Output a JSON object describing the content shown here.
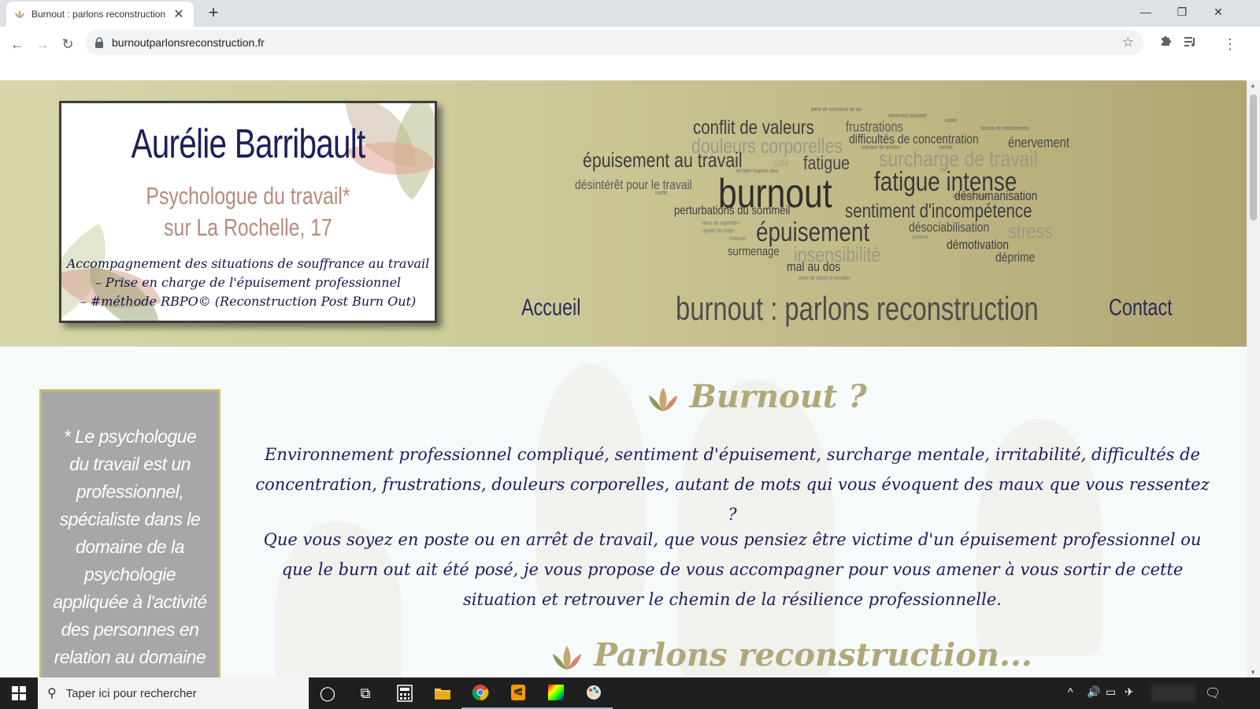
{
  "browser": {
    "tab_title": "Burnout : parlons reconstruction",
    "tab_close": "✕",
    "new_tab": "+",
    "url": "burnoutparlonsreconstruction.fr",
    "win_min": "—",
    "win_max": "❐",
    "win_close": "✕",
    "back": "←",
    "forward": "→",
    "reload": "↻",
    "star": "☆",
    "menu": "⋮"
  },
  "header": {
    "name": "Aurélie Barribault",
    "subtitle_line1": "Psychologue du travail*",
    "subtitle_line2": "sur La Rochelle, 17",
    "desc_line1": "Accompagnement des situations de souffrance au travail",
    "desc_line2": "– Prise en charge de l'épuisement professionnel",
    "desc_line3": "– #méthode RBPO© (Reconstruction Post Burn Out)"
  },
  "word_cloud": [
    {
      "t": "conflit de valeurs"
    },
    {
      "t": "frustrations"
    },
    {
      "t": "douleurs corporelles"
    },
    {
      "t": "difficultés de concentration"
    },
    {
      "t": "énervement"
    },
    {
      "t": "épuisement au travail"
    },
    {
      "t": "fatigue"
    },
    {
      "t": "surcharge de travail"
    },
    {
      "t": "burnout"
    },
    {
      "t": "fatigue intense"
    },
    {
      "t": "désintérêt pour le travail"
    },
    {
      "t": "déshumanisation"
    },
    {
      "t": "perturbations du sommeil"
    },
    {
      "t": "sentiment d'incompétence"
    },
    {
      "t": "épuisement"
    },
    {
      "t": "désociabilisation"
    },
    {
      "t": "stress"
    },
    {
      "t": "surmenage"
    },
    {
      "t": "insensibilité"
    },
    {
      "t": "démotivation"
    },
    {
      "t": "déprime"
    },
    {
      "t": "mal au dos"
    },
    {
      "t": "café"
    },
    {
      "t": "perte de confiance en soi"
    },
    {
      "t": "sentiment d'inutilité"
    },
    {
      "t": "oublis"
    },
    {
      "t": "besoin de médicaments"
    },
    {
      "t": "manque de soutien"
    },
    {
      "t": "suicide"
    },
    {
      "t": "en faire toujours plus"
    },
    {
      "t": "manque de temps"
    },
    {
      "t": "abus de cigarettes"
    },
    {
      "t": "rigidité du corps"
    },
    {
      "t": "tristesse"
    },
    {
      "t": "cynisme"
    },
    {
      "t": "perte de plaisir à travailler"
    },
    {
      "t": "conflit"
    }
  ],
  "nav": {
    "home": "Accueil",
    "main": "burnout : parlons reconstruction",
    "contact": "Contact"
  },
  "note": "* Le psychologue du travail est un professionnel, spécialiste dans le domaine de la psychologie appliquée à l'activité des personnes en relation au domaine du travail.",
  "section1": {
    "title": "Burnout ?",
    "para1": "Environnement professionnel compliqué, sentiment d'épuisement, surcharge mentale, irritabilité, difficultés de concentration, frustrations, douleurs corporelles, autant de mots qui vous évoquent des maux que vous ressentez ?",
    "para2": "Que vous soyez en poste ou en arrêt de travail, que vous pensiez être victime d'un épuisement professionnel ou que le burn out ait été posé, je vous propose de vous accompagner pour vous amener à vous sortir de cette situation et retrouver le chemin de la résilience professionnelle."
  },
  "section2": {
    "title": "Parlons reconstruction..."
  },
  "taskbar": {
    "search_placeholder": "Taper ici pour rechercher"
  },
  "colors": {
    "header_left": "#d6d6a9",
    "header_right": "#b0a672",
    "navy": "#1e1e5a",
    "title_gold": "#b0a878"
  }
}
